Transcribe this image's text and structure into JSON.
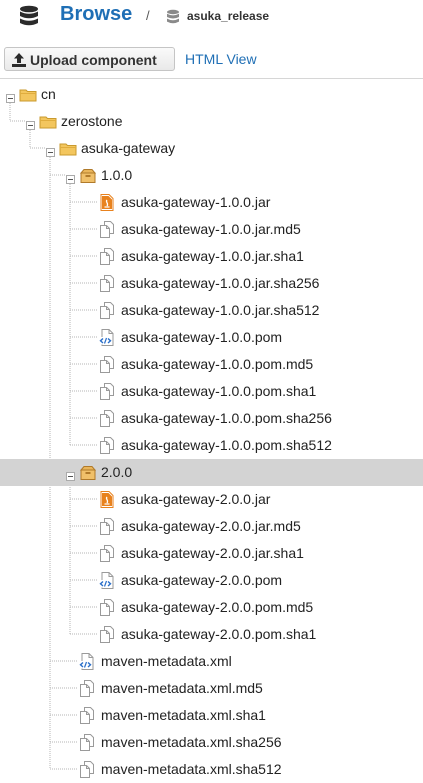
{
  "header": {
    "title": "Browse",
    "separator": "/",
    "repo_name": "asuka_release",
    "icons": {
      "title": "database-icon",
      "repo": "database-icon"
    }
  },
  "toolbar": {
    "upload_label": "Upload component",
    "html_view_label": "HTML View",
    "upload_icon": "upload-icon"
  },
  "tree": {
    "selected": "2.0.0",
    "nodes": [
      {
        "label": "cn",
        "type": "folder",
        "depth": 0,
        "expanded": true
      },
      {
        "label": "zerostone",
        "type": "folder",
        "depth": 1,
        "expanded": true
      },
      {
        "label": "asuka-gateway",
        "type": "folder",
        "depth": 2,
        "expanded": true
      },
      {
        "label": "1.0.0",
        "type": "component",
        "depth": 3,
        "expanded": true
      },
      {
        "label": "asuka-gateway-1.0.0.jar",
        "type": "jar",
        "depth": 4
      },
      {
        "label": "asuka-gateway-1.0.0.jar.md5",
        "type": "file",
        "depth": 4
      },
      {
        "label": "asuka-gateway-1.0.0.jar.sha1",
        "type": "file",
        "depth": 4
      },
      {
        "label": "asuka-gateway-1.0.0.jar.sha256",
        "type": "file",
        "depth": 4
      },
      {
        "label": "asuka-gateway-1.0.0.jar.sha512",
        "type": "file",
        "depth": 4
      },
      {
        "label": "asuka-gateway-1.0.0.pom",
        "type": "xml",
        "depth": 4
      },
      {
        "label": "asuka-gateway-1.0.0.pom.md5",
        "type": "file",
        "depth": 4
      },
      {
        "label": "asuka-gateway-1.0.0.pom.sha1",
        "type": "file",
        "depth": 4
      },
      {
        "label": "asuka-gateway-1.0.0.pom.sha256",
        "type": "file",
        "depth": 4
      },
      {
        "label": "asuka-gateway-1.0.0.pom.sha512",
        "type": "file",
        "depth": 4
      },
      {
        "label": "2.0.0",
        "type": "component",
        "depth": 3,
        "expanded": true
      },
      {
        "label": "asuka-gateway-2.0.0.jar",
        "type": "jar",
        "depth": 4
      },
      {
        "label": "asuka-gateway-2.0.0.jar.md5",
        "type": "file",
        "depth": 4
      },
      {
        "label": "asuka-gateway-2.0.0.jar.sha1",
        "type": "file",
        "depth": 4
      },
      {
        "label": "asuka-gateway-2.0.0.pom",
        "type": "xml",
        "depth": 4
      },
      {
        "label": "asuka-gateway-2.0.0.pom.md5",
        "type": "file",
        "depth": 4
      },
      {
        "label": "asuka-gateway-2.0.0.pom.sha1",
        "type": "file",
        "depth": 4
      },
      {
        "label": "maven-metadata.xml",
        "type": "xml",
        "depth": 3
      },
      {
        "label": "maven-metadata.xml.md5",
        "type": "file",
        "depth": 3
      },
      {
        "label": "maven-metadata.xml.sha1",
        "type": "file",
        "depth": 3
      },
      {
        "label": "maven-metadata.xml.sha256",
        "type": "file",
        "depth": 3
      },
      {
        "label": "maven-metadata.xml.sha512",
        "type": "file",
        "depth": 3
      }
    ]
  },
  "colors": {
    "accent": "#1f6fb5",
    "selected_row": "#d3d3d3",
    "folder": "#f3c65e",
    "jar": "#e8821e",
    "xml_badge": "#2a6fc9"
  }
}
